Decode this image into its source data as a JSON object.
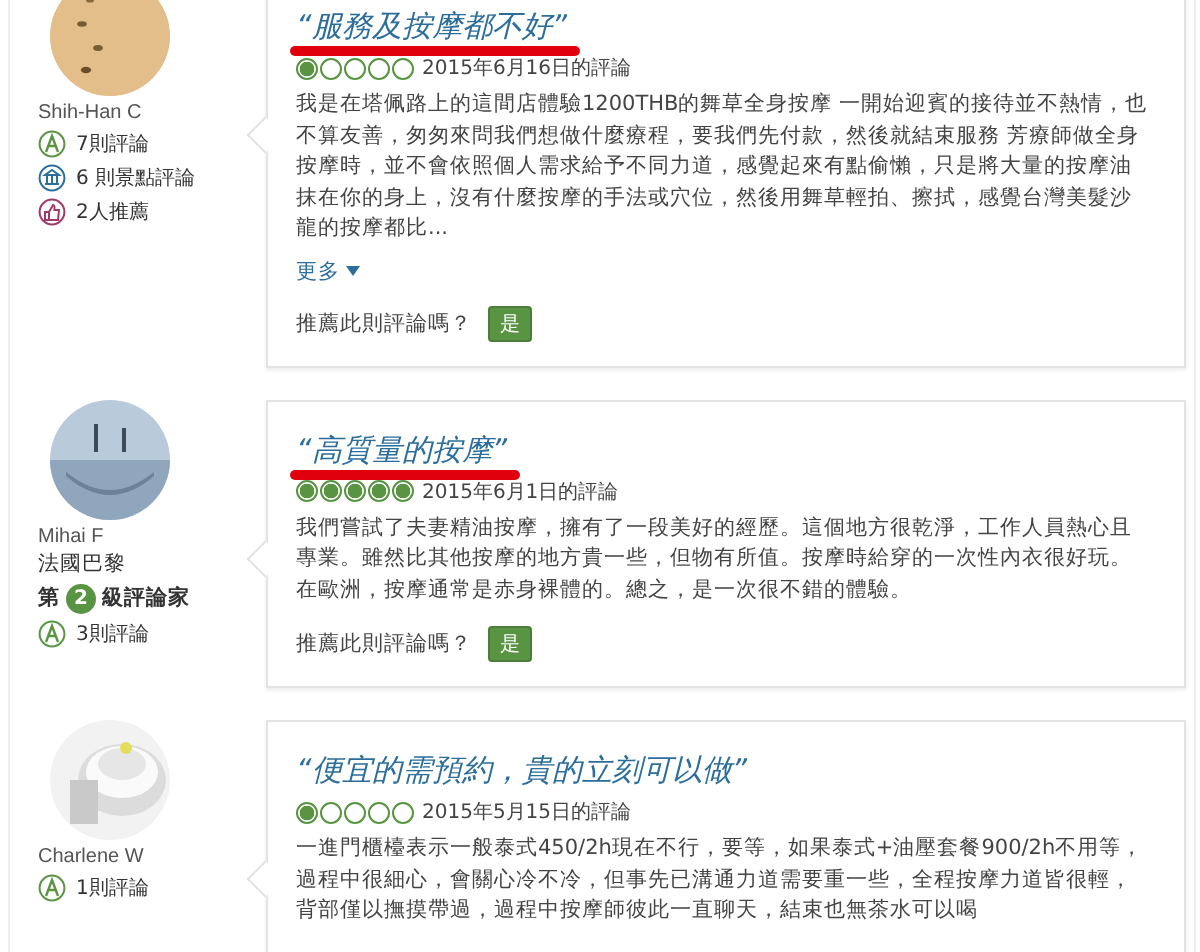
{
  "reviews": [
    {
      "reviewer": {
        "name": "Shih-Han C",
        "stats": [
          {
            "kind": "reviews",
            "label": "7則評論"
          },
          {
            "kind": "attractions",
            "label": "6 則景點評論"
          },
          {
            "kind": "helpful",
            "label": "2人推薦"
          }
        ]
      },
      "title": "“服務及按摩都不好”",
      "underlined": true,
      "stars": 1,
      "date": "2015年6月16日的評論",
      "body": "我是在塔佩路上的這間店體驗1200THB的舞草全身按摩 一開始迎賓的接待並不熱情，也不算友善，匆匆來問我們想做什麼療程，要我們先付款，然後就結束服務 芳療師做全身按摩時，並不會依照個人需求給予不同力道，感覺起來有點偷懶，只是將大量的按摩油抹在你的身上，沒有什麼按摩的手法或穴位，然後用舞草輕拍、擦拭，感覺台灣美髮沙龍的按摩都比...",
      "more": "更多",
      "helpful_prompt": "推薦此則評論嗎？",
      "helpful_button": "是"
    },
    {
      "reviewer": {
        "name": "Mihai F",
        "location": "法國巴黎",
        "level": {
          "prefix": "第",
          "number": "2",
          "suffix": "級評論家"
        },
        "stats": [
          {
            "kind": "reviews",
            "label": "3則評論"
          }
        ]
      },
      "title": "“高質量的按摩”",
      "underlined": true,
      "stars": 5,
      "date": "2015年6月1日的評論",
      "body": "我們嘗試了夫妻精油按摩，擁有了一段美好的經歷。這個地方很乾淨，工作人員熱心且專業。雖然比其他按摩的地方貴一些，但物有所值。按摩時給穿的一次性內衣很好玩。在歐洲，按摩通常是赤身裸體的。總之，是一次很不錯的體驗。",
      "helpful_prompt": "推薦此則評論嗎？",
      "helpful_button": "是"
    },
    {
      "reviewer": {
        "name": "Charlene W",
        "stats": [
          {
            "kind": "reviews",
            "label": "1則評論"
          }
        ]
      },
      "title": "“便宜的需預約，貴的立刻可以做”",
      "underlined": false,
      "stars": 1,
      "date": "2015年5月15日的評論",
      "body": "一進門櫃檯表示一般泰式450/2h現在不行，要等，如果泰式+油壓套餐900/2h不用等，過程中很細心，會關心冷不冷，但事先已溝通力道需要重一些，全程按摩力道皆很輕，背部僅以撫摸帶過，過程中按摩師彼此一直聊天，結束也無茶水可以喝"
    }
  ]
}
